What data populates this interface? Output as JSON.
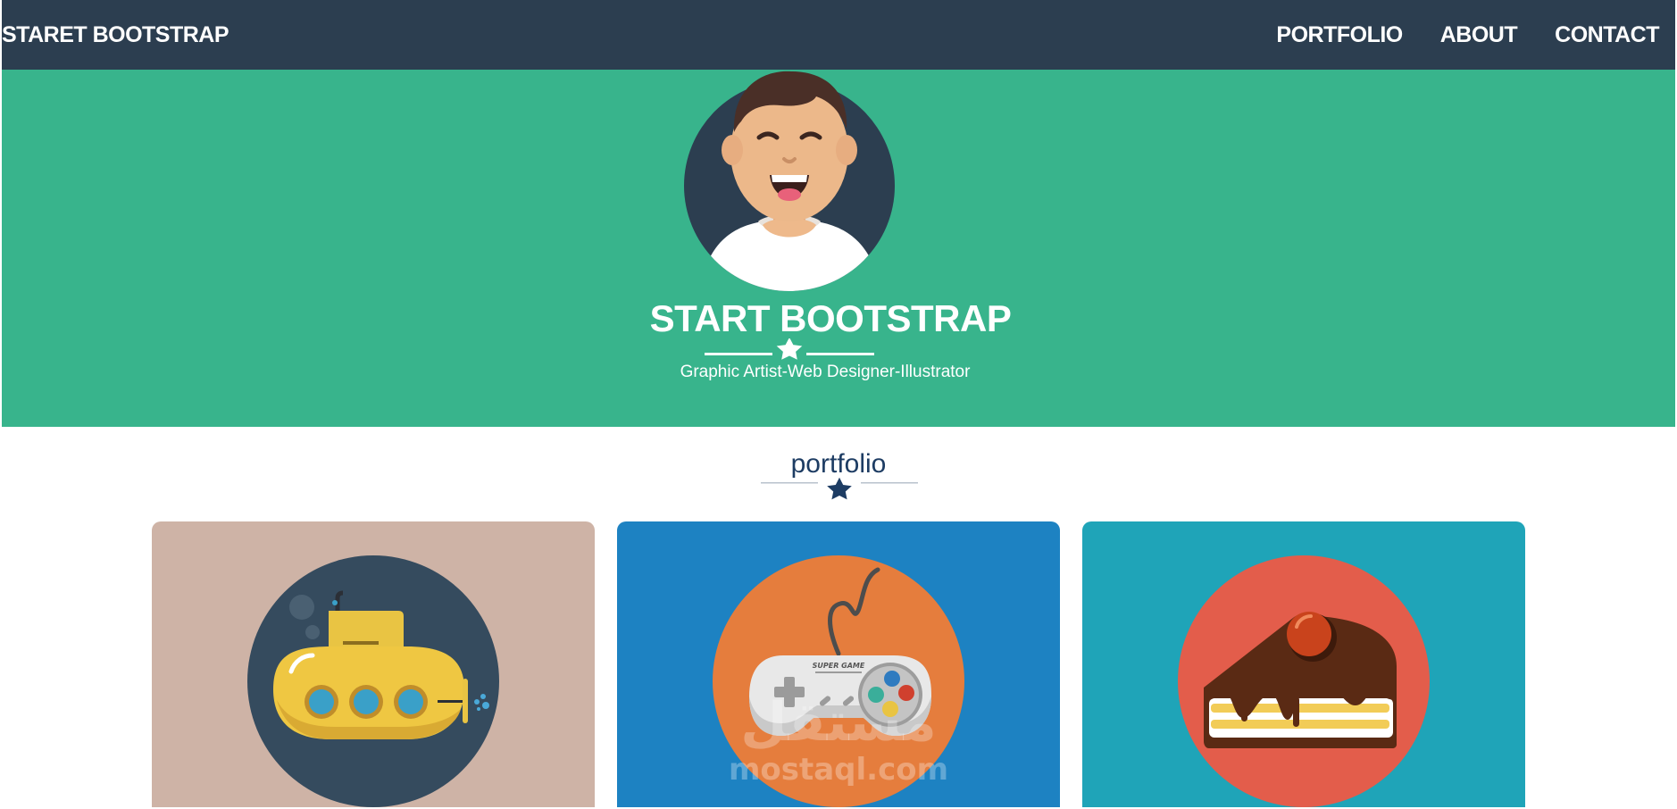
{
  "navbar": {
    "brand": "STARET BOOTSTRAP",
    "links": [
      "PORTFOLIO",
      "ABOUT",
      "CONTACT"
    ]
  },
  "header": {
    "title": "START BOOTSTRAP",
    "subtitle": "Graphic Artist-Web Designer-Illustrator"
  },
  "portfolio": {
    "title": "portfolio",
    "items": [
      {
        "illustration": "submarine",
        "background": "#ceb3a6",
        "circle": "#354b5e"
      },
      {
        "illustration": "game-controller",
        "background": "#1d82c2",
        "circle": "#e57d3d",
        "label": "SUPER GAME"
      },
      {
        "illustration": "cake-slice",
        "background": "#1fa4b8",
        "circle": "#e35d4b"
      }
    ]
  },
  "watermark": {
    "arabic": "مستقل",
    "latin": "mostaql.com"
  },
  "colors": {
    "navbar": "#2c3e50",
    "hero": "#38b48c",
    "section_title": "#1d3c63"
  }
}
